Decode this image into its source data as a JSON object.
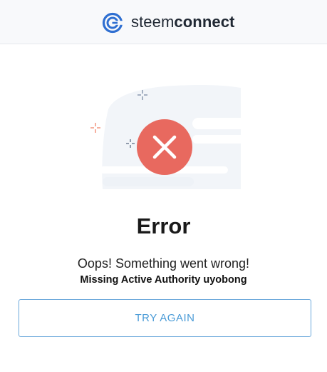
{
  "header": {
    "brand_light": "steem",
    "brand_bold": "connect"
  },
  "main": {
    "title": "Error",
    "message": "Oops! Something went wrong!",
    "detail": "Missing Active Authority uyobong",
    "try_again_label": "TRY AGAIN"
  },
  "icons": {
    "logo": "steemconnect-logo-icon",
    "status": "error-x-icon"
  },
  "colors": {
    "accent": "#4a9bd7",
    "error": "#e8695f",
    "logo": "#2f6fd1"
  }
}
